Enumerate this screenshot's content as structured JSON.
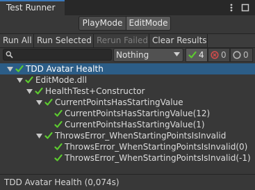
{
  "window": {
    "tab_title": "Test Runner",
    "icons": [
      "menu-icon",
      "maximize-icon"
    ]
  },
  "mode": {
    "play_label": "PlayMode",
    "edit_label": "EditMode",
    "selected": "EditMode"
  },
  "toolbar": {
    "run_all": "Run All",
    "run_selected": "Run Selected",
    "rerun_failed": "Rerun Failed",
    "clear_results": "Clear Results"
  },
  "filter": {
    "search_value": "",
    "dropdown_value": "Nothing",
    "passed_count": "4",
    "failed_count": "0",
    "skipped_count": "0"
  },
  "tree": [
    {
      "label": "TDD Avatar Health",
      "status": "passed",
      "expanded": true,
      "selected": true
    },
    {
      "label": "EditMode.dll",
      "status": "passed",
      "expanded": true
    },
    {
      "label": "HealthTest+Constructor",
      "status": "passed",
      "expanded": true
    },
    {
      "label": "CurrentPointsHasStartingValue",
      "status": "passed",
      "expanded": true
    },
    {
      "label": "CurrentPointsHasStartingValue(12)",
      "status": "passed"
    },
    {
      "label": "CurrentPointsHasStartingValue(1)",
      "status": "passed"
    },
    {
      "label": "ThrowsError_WhenStartingPointsIsInvalid",
      "status": "passed",
      "expanded": true
    },
    {
      "label": "ThrowsError_WhenStartingPointsIsInvalid(0)",
      "status": "passed"
    },
    {
      "label": "ThrowsError_WhenStartingPointsIsInvalid(-1)",
      "status": "passed"
    }
  ],
  "status_bar": {
    "text": "TDD Avatar Health (0,074s)"
  },
  "colors": {
    "accent": "#3a79bb",
    "selection": "#2c5d87",
    "pass_green": "#5dcc2f",
    "fail_red": "#d24b4b",
    "skip_gray": "#b4b4b4"
  }
}
